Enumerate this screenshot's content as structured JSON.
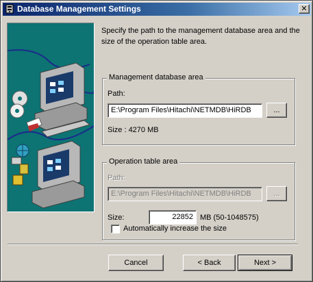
{
  "window": {
    "title": "Database Management Settings",
    "close_symbol": "✕"
  },
  "intro_text": "Specify the path to the management database area and the size of the operation table area.",
  "management_group": {
    "legend": "Management database area",
    "path_label": "Path:",
    "path_value": "E:\\Program Files\\Hitachi\\NETMDB\\HiRDB",
    "browse_label": "...",
    "size_text": "Size : 4270 MB"
  },
  "operation_group": {
    "legend": "Operation table area",
    "path_label": "Path:",
    "path_value": "E:\\Program Files\\Hitachi\\NETMDB\\HiRDB",
    "browse_label": "...",
    "size_label": "Size:",
    "size_value": "22852",
    "size_unit": "MB (50-1048575)",
    "auto_increase_label": "Automatically increase the size",
    "auto_increase_checked": false
  },
  "buttons": {
    "cancel": "Cancel",
    "back": "< Back",
    "next": "Next >"
  },
  "icons": {
    "title": "database-settings-icon",
    "illustration": "networked-computers-illustration"
  }
}
